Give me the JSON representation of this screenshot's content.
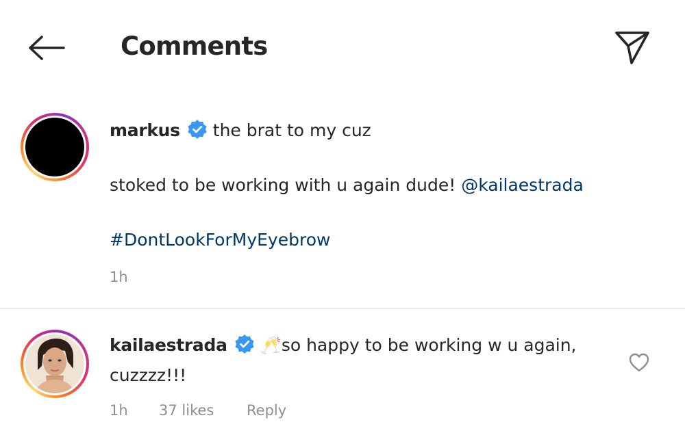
{
  "header": {
    "title": "Comments",
    "back_icon": "arrow-left-icon",
    "share_icon": "paper-plane-icon"
  },
  "caption": {
    "username": "markus",
    "verified": true,
    "text_line1": "the brat to my cuz",
    "text_line2": "stoked to be working with u again dude!",
    "mention": "@kailaestrada",
    "hashtag": "#DontLookForMyEyebrow",
    "time": "1h"
  },
  "comments": [
    {
      "username": "kailaestrada",
      "verified": true,
      "emoji": "🥂",
      "text_line1": "so happy to be working w u again,",
      "text_line2": "cuzzzz!!!",
      "time": "1h",
      "likes": "37 likes",
      "reply_label": "Reply"
    }
  ],
  "colors": {
    "text": "#262626",
    "secondary": "#8e8e8e",
    "link": "#00376b",
    "verified_badge": "#3897f0",
    "divider": "#dbdbdb"
  }
}
